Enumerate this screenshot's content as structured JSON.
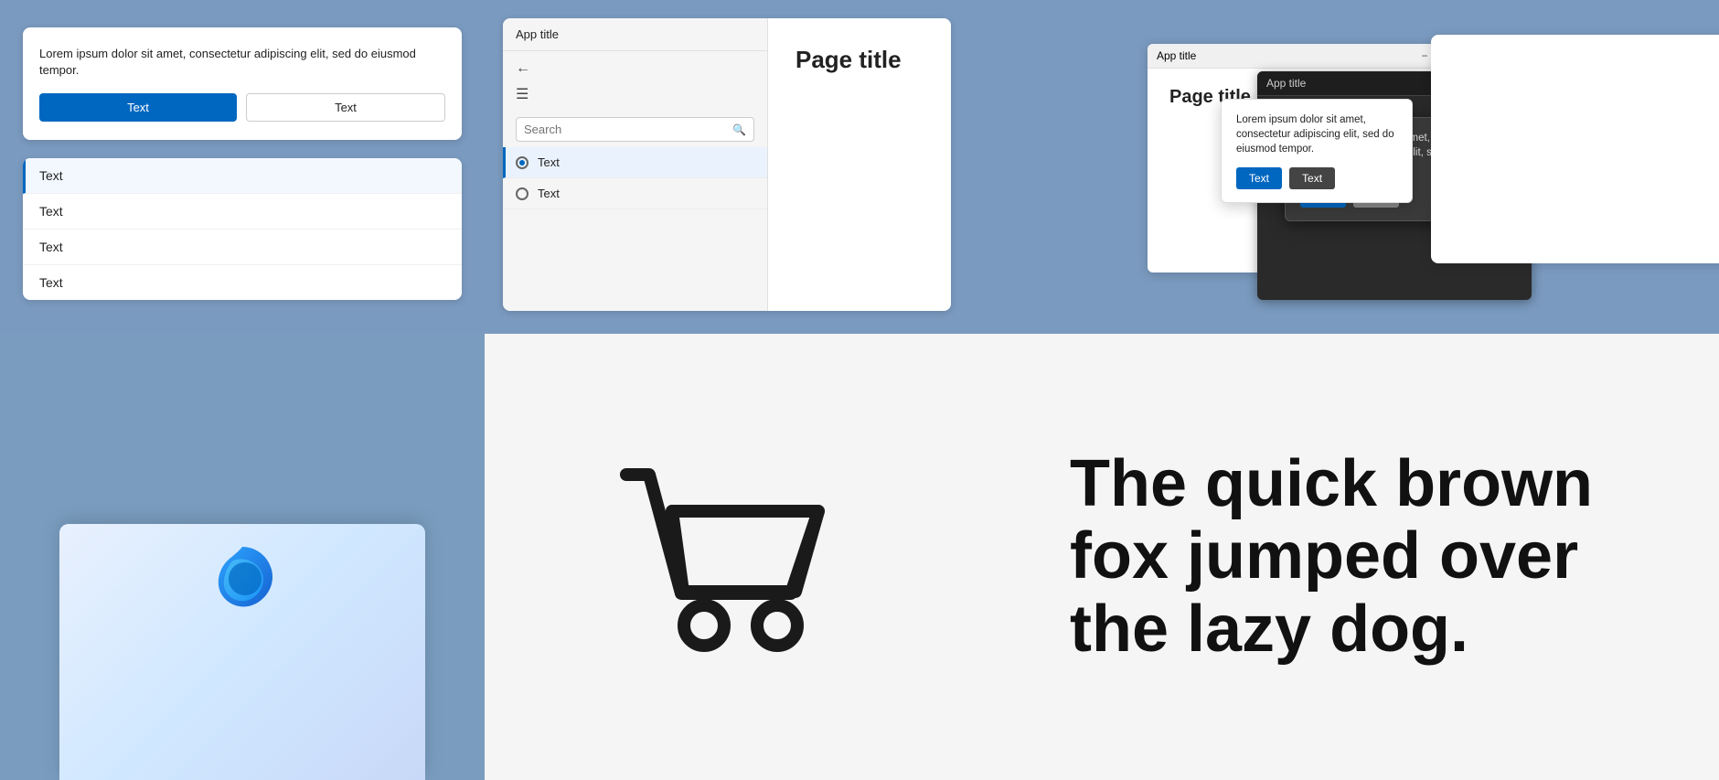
{
  "colors": {
    "blue_bg": "#7a9abf",
    "white": "#ffffff",
    "accent": "#0067c0",
    "light_bg": "#f5f5f5"
  },
  "cell1": {
    "dialog": {
      "body_text": "Lorem ipsum dolor sit amet, consectetur adipiscing elit, sed do eiusmod tempor.",
      "btn1": "Text",
      "btn2": "Text"
    },
    "list": {
      "items": [
        "Text",
        "Text",
        "Text",
        "Text"
      ]
    }
  },
  "cell2": {
    "app_title": "App title",
    "page_title": "Page title",
    "search_placeholder": "Search",
    "nav": {
      "items": [
        {
          "label": "Text",
          "active": true
        },
        {
          "label": "Text",
          "active": false
        }
      ]
    }
  },
  "cell3": {
    "split_app": {
      "title": "App title",
      "page_title": "Page title",
      "dialog_text": "Lorem ipsum dolor sit amet, consectetur adipiscing elit, sed do eiusmod tempor.",
      "btn1": "Text",
      "btn2": "Text"
    }
  },
  "cell4": {
    "label": "Browser window"
  },
  "cell5": {
    "label": "Shopping cart icon"
  },
  "cell6": {
    "text": "The quick brown fox jumped over the lazy dog."
  }
}
